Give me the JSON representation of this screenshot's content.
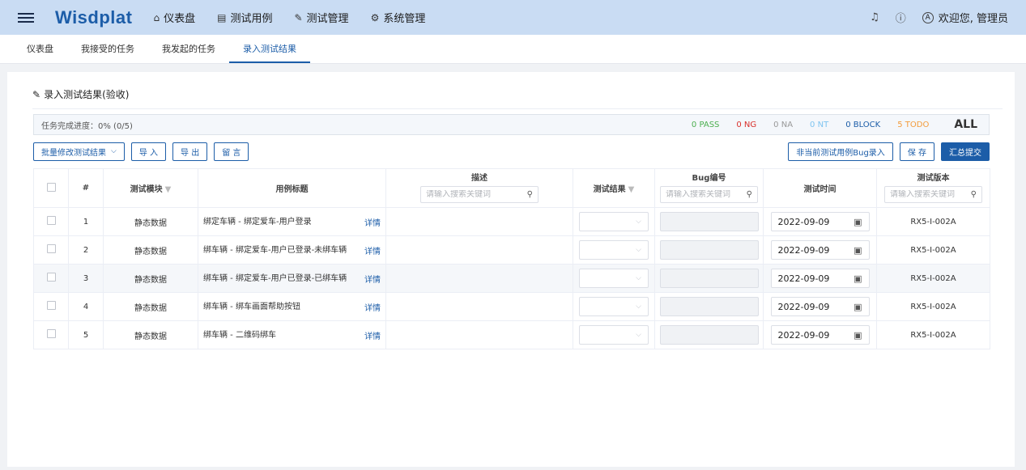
{
  "header": {
    "logo": "Wisdplat",
    "nav": [
      {
        "icon": "home-icon",
        "glyph": "⌂",
        "label": "仪表盘"
      },
      {
        "icon": "list-icon",
        "glyph": "▤",
        "label": "测试用例"
      },
      {
        "icon": "wrench-icon",
        "glyph": "✎",
        "label": "测试管理"
      },
      {
        "icon": "gear-icon",
        "glyph": "⚙",
        "label": "系统管理"
      }
    ],
    "welcome": "欢迎您, 管理员"
  },
  "tabs": [
    "仪表盘",
    "我接受的任务",
    "我发起的任务",
    "录入测试结果"
  ],
  "active_tab": 3,
  "card": {
    "title": "录入测试结果(验收)",
    "progress": "任务完成进度：0% (0/5)",
    "stats": [
      {
        "label": "0 PASS",
        "color": "#4caf50"
      },
      {
        "label": "0 NG",
        "color": "#d9302b"
      },
      {
        "label": "0 NA",
        "color": "#999999"
      },
      {
        "label": "0 NT",
        "color": "#7fc4f0"
      },
      {
        "label": "0 BLOCK",
        "color": "#1c5da8"
      },
      {
        "label": "5 TODO",
        "color": "#f39c3c"
      }
    ],
    "stat_all": "ALL"
  },
  "toolbar": {
    "batch_edit": "批量修改测试结果",
    "import": "导 入",
    "export": "导 出",
    "comment": "留 言",
    "non_case_bug": "非当前测试用例Bug录入",
    "save": "保 存",
    "submit": "汇总提交"
  },
  "table": {
    "headers": {
      "index": "#",
      "module": "测试模块",
      "title": "用例标题",
      "desc": "描述",
      "result": "测试结果",
      "bug": "Bug编号",
      "time": "测试时间",
      "version": "测试版本"
    },
    "search_placeholder": "请输入搜索关键词",
    "detail_label": "详情",
    "rows": [
      {
        "index": "1",
        "module": "静态数据",
        "title": "绑定车辆 - 绑定爱车-用户登录",
        "date": "2022-09-09",
        "version": "RX5-I-002A"
      },
      {
        "index": "2",
        "module": "静态数据",
        "title": "绑车辆 - 绑定爱车-用户已登录-未绑车辆",
        "date": "2022-09-09",
        "version": "RX5-I-002A"
      },
      {
        "index": "3",
        "module": "静态数据",
        "title": "绑车辆 - 绑定爱车-用户已登录-已绑车辆",
        "date": "2022-09-09",
        "version": "RX5-I-002A"
      },
      {
        "index": "4",
        "module": "静态数据",
        "title": "绑车辆 - 绑车画面帮助按钮",
        "date": "2022-09-09",
        "version": "RX5-I-002A"
      },
      {
        "index": "5",
        "module": "静态数据",
        "title": "绑车辆 - 二维码绑车",
        "date": "2022-09-09",
        "version": "RX5-I-002A"
      }
    ]
  }
}
